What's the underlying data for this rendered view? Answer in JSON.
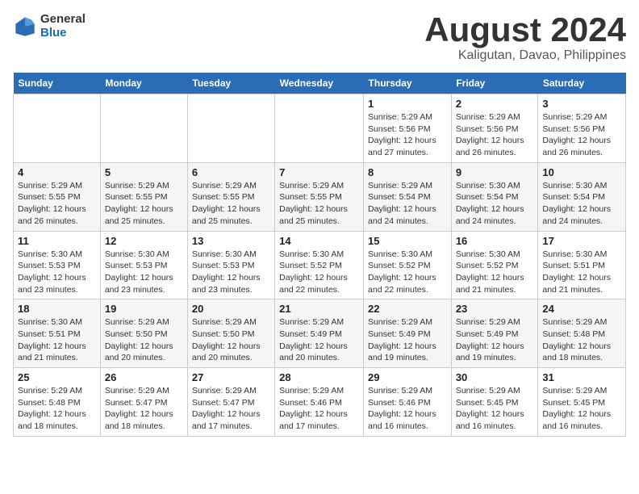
{
  "header": {
    "logo_general": "General",
    "logo_blue": "Blue",
    "title": "August 2024",
    "location": "Kaligutan, Davao, Philippines"
  },
  "weekdays": [
    "Sunday",
    "Monday",
    "Tuesday",
    "Wednesday",
    "Thursday",
    "Friday",
    "Saturday"
  ],
  "weeks": [
    [
      {
        "day": "",
        "content": ""
      },
      {
        "day": "",
        "content": ""
      },
      {
        "day": "",
        "content": ""
      },
      {
        "day": "",
        "content": ""
      },
      {
        "day": "1",
        "content": "Sunrise: 5:29 AM\nSunset: 5:56 PM\nDaylight: 12 hours\nand 27 minutes."
      },
      {
        "day": "2",
        "content": "Sunrise: 5:29 AM\nSunset: 5:56 PM\nDaylight: 12 hours\nand 26 minutes."
      },
      {
        "day": "3",
        "content": "Sunrise: 5:29 AM\nSunset: 5:56 PM\nDaylight: 12 hours\nand 26 minutes."
      }
    ],
    [
      {
        "day": "4",
        "content": "Sunrise: 5:29 AM\nSunset: 5:55 PM\nDaylight: 12 hours\nand 26 minutes."
      },
      {
        "day": "5",
        "content": "Sunrise: 5:29 AM\nSunset: 5:55 PM\nDaylight: 12 hours\nand 25 minutes."
      },
      {
        "day": "6",
        "content": "Sunrise: 5:29 AM\nSunset: 5:55 PM\nDaylight: 12 hours\nand 25 minutes."
      },
      {
        "day": "7",
        "content": "Sunrise: 5:29 AM\nSunset: 5:55 PM\nDaylight: 12 hours\nand 25 minutes."
      },
      {
        "day": "8",
        "content": "Sunrise: 5:29 AM\nSunset: 5:54 PM\nDaylight: 12 hours\nand 24 minutes."
      },
      {
        "day": "9",
        "content": "Sunrise: 5:30 AM\nSunset: 5:54 PM\nDaylight: 12 hours\nand 24 minutes."
      },
      {
        "day": "10",
        "content": "Sunrise: 5:30 AM\nSunset: 5:54 PM\nDaylight: 12 hours\nand 24 minutes."
      }
    ],
    [
      {
        "day": "11",
        "content": "Sunrise: 5:30 AM\nSunset: 5:53 PM\nDaylight: 12 hours\nand 23 minutes."
      },
      {
        "day": "12",
        "content": "Sunrise: 5:30 AM\nSunset: 5:53 PM\nDaylight: 12 hours\nand 23 minutes."
      },
      {
        "day": "13",
        "content": "Sunrise: 5:30 AM\nSunset: 5:53 PM\nDaylight: 12 hours\nand 23 minutes."
      },
      {
        "day": "14",
        "content": "Sunrise: 5:30 AM\nSunset: 5:52 PM\nDaylight: 12 hours\nand 22 minutes."
      },
      {
        "day": "15",
        "content": "Sunrise: 5:30 AM\nSunset: 5:52 PM\nDaylight: 12 hours\nand 22 minutes."
      },
      {
        "day": "16",
        "content": "Sunrise: 5:30 AM\nSunset: 5:52 PM\nDaylight: 12 hours\nand 21 minutes."
      },
      {
        "day": "17",
        "content": "Sunrise: 5:30 AM\nSunset: 5:51 PM\nDaylight: 12 hours\nand 21 minutes."
      }
    ],
    [
      {
        "day": "18",
        "content": "Sunrise: 5:30 AM\nSunset: 5:51 PM\nDaylight: 12 hours\nand 21 minutes."
      },
      {
        "day": "19",
        "content": "Sunrise: 5:29 AM\nSunset: 5:50 PM\nDaylight: 12 hours\nand 20 minutes."
      },
      {
        "day": "20",
        "content": "Sunrise: 5:29 AM\nSunset: 5:50 PM\nDaylight: 12 hours\nand 20 minutes."
      },
      {
        "day": "21",
        "content": "Sunrise: 5:29 AM\nSunset: 5:49 PM\nDaylight: 12 hours\nand 20 minutes."
      },
      {
        "day": "22",
        "content": "Sunrise: 5:29 AM\nSunset: 5:49 PM\nDaylight: 12 hours\nand 19 minutes."
      },
      {
        "day": "23",
        "content": "Sunrise: 5:29 AM\nSunset: 5:49 PM\nDaylight: 12 hours\nand 19 minutes."
      },
      {
        "day": "24",
        "content": "Sunrise: 5:29 AM\nSunset: 5:48 PM\nDaylight: 12 hours\nand 18 minutes."
      }
    ],
    [
      {
        "day": "25",
        "content": "Sunrise: 5:29 AM\nSunset: 5:48 PM\nDaylight: 12 hours\nand 18 minutes."
      },
      {
        "day": "26",
        "content": "Sunrise: 5:29 AM\nSunset: 5:47 PM\nDaylight: 12 hours\nand 18 minutes."
      },
      {
        "day": "27",
        "content": "Sunrise: 5:29 AM\nSunset: 5:47 PM\nDaylight: 12 hours\nand 17 minutes."
      },
      {
        "day": "28",
        "content": "Sunrise: 5:29 AM\nSunset: 5:46 PM\nDaylight: 12 hours\nand 17 minutes."
      },
      {
        "day": "29",
        "content": "Sunrise: 5:29 AM\nSunset: 5:46 PM\nDaylight: 12 hours\nand 16 minutes."
      },
      {
        "day": "30",
        "content": "Sunrise: 5:29 AM\nSunset: 5:45 PM\nDaylight: 12 hours\nand 16 minutes."
      },
      {
        "day": "31",
        "content": "Sunrise: 5:29 AM\nSunset: 5:45 PM\nDaylight: 12 hours\nand 16 minutes."
      }
    ]
  ]
}
